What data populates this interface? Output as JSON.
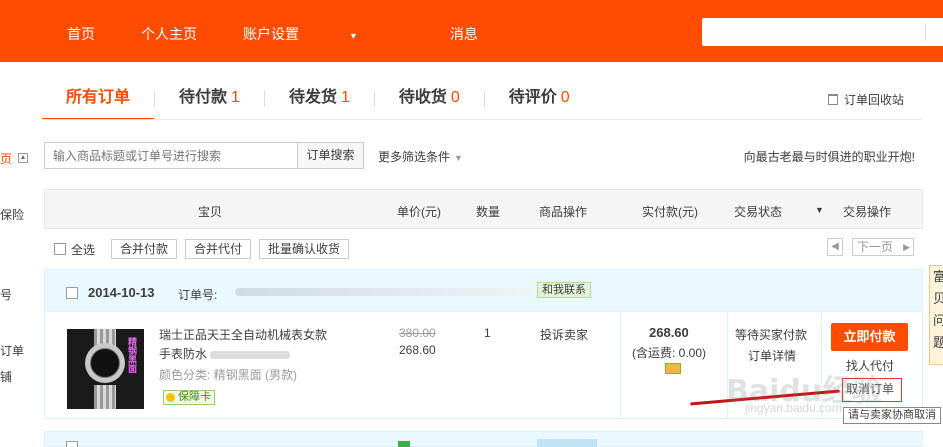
{
  "topnav": {
    "items": [
      "首页",
      "个人主页",
      "账户设置",
      "消息"
    ],
    "search_placeholder": ""
  },
  "tabs": [
    {
      "label": "所有订单",
      "count": ""
    },
    {
      "label": "待付款",
      "count": "1"
    },
    {
      "label": "待发货",
      "count": "1"
    },
    {
      "label": "待收货",
      "count": "0"
    },
    {
      "label": "待评价",
      "count": "0"
    }
  ],
  "recycle_label": "订单回收站",
  "sidebar": {
    "items": [
      "页",
      "保险",
      "号",
      "订单",
      "铺"
    ]
  },
  "search": {
    "placeholder": "输入商品标题或订单号进行搜索",
    "button": "订单搜索",
    "more_filter": "更多筛选条件",
    "slogan": "向最古老最与时俱进的职业开炮!"
  },
  "table_header": {
    "item": "宝贝",
    "unit_price": "单价(元)",
    "quantity": "数量",
    "item_ops": "商品操作",
    "paid": "实付款(元)",
    "status": "交易状态",
    "trade_ops": "交易操作"
  },
  "batch": {
    "select_all": "全选",
    "merge_pay": "合并付款",
    "merge_proxy": "合并代付",
    "batch_confirm": "批量确认收货",
    "prev": "◀",
    "next": "下一页",
    "next_arrow": "▶"
  },
  "order": {
    "date": "2014-10-13",
    "order_no_label": "订单号:",
    "shop_label": "和我联系",
    "product_name_line1": "瑞士正品天王全自动机械表女款",
    "product_name_line2": "手表防水",
    "product_attr": "颜色分类: 精钢黑面 (男款)",
    "guarantee": "保障卡",
    "original_price": "380.00",
    "unit_price": "268.60",
    "quantity": "1",
    "item_op": "投诉卖家",
    "paid": "268.60",
    "shipping": "(含运费: 0.00)",
    "status": "等待买家付款",
    "detail": "订单详情",
    "pay_button": "立即付款",
    "proxy_pay": "找人代付",
    "cancel": "取消订单",
    "watch_text": "精钢黑面"
  },
  "tooltip": "请与卖家协商取消",
  "watermark": {
    "brand": "Baidu经验",
    "url": "jingyan.baidu.com"
  },
  "right_panel_text": "富贝问题"
}
